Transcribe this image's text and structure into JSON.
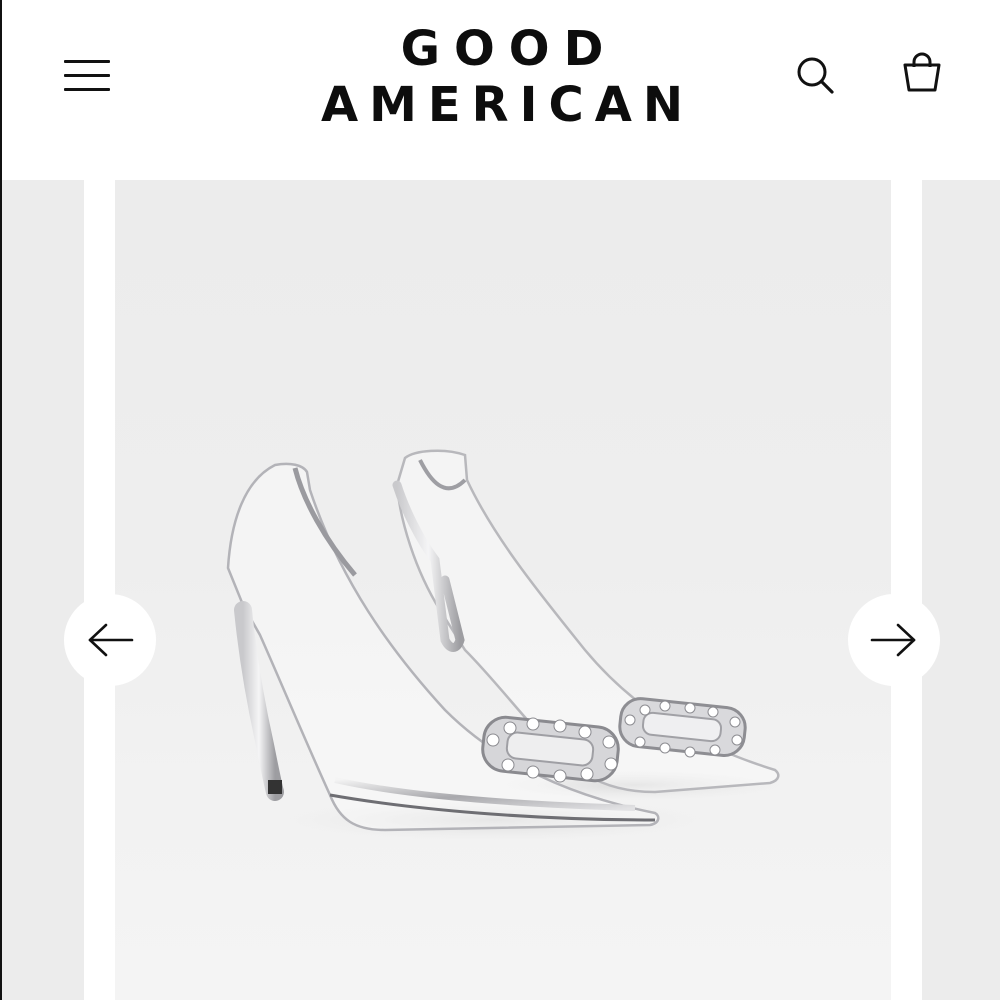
{
  "header": {
    "brand_line1": "GOOD",
    "brand_line2": "AMERICAN",
    "menu_icon": "hamburger-menu-icon",
    "search_icon": "search-icon",
    "cart_icon": "shopping-bag-icon"
  },
  "carousel": {
    "prev_icon": "arrow-left-icon",
    "next_icon": "arrow-right-icon",
    "image_subject": "clear-pointed-heels-with-crystal-buckle"
  },
  "colors": {
    "text": "#0d0d0d",
    "slide_background": "#ececec",
    "button_background": "#ffffff"
  }
}
